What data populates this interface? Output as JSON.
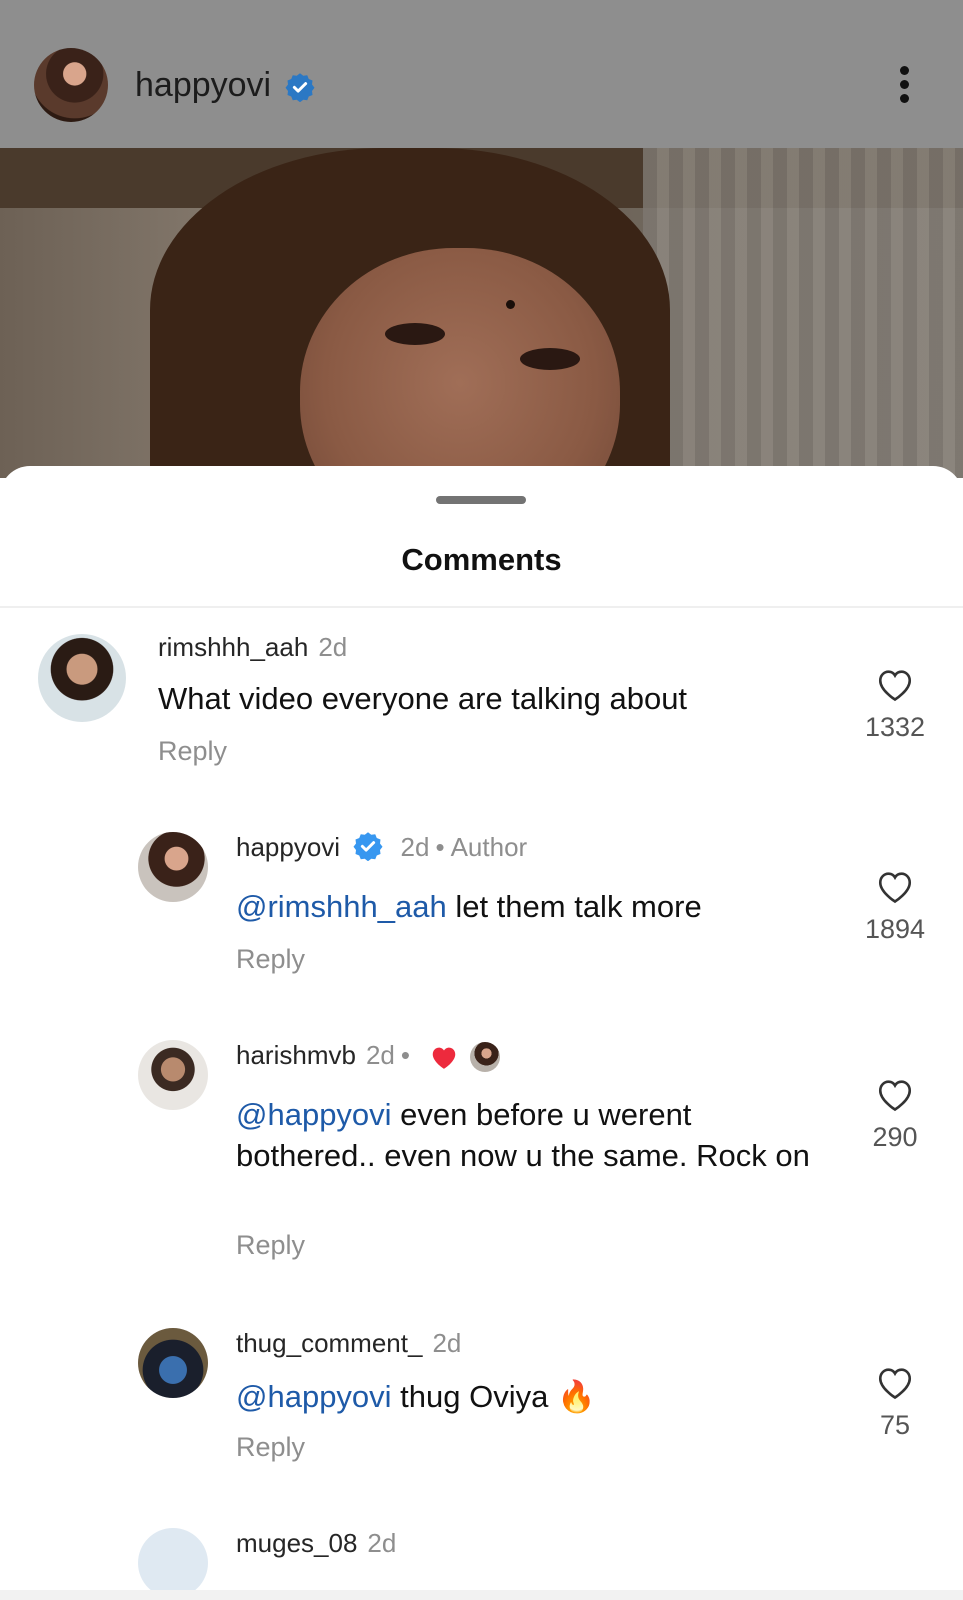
{
  "post_header": {
    "username": "happyovi",
    "verified": true,
    "more_icon": "more-vertical-icon"
  },
  "sheet": {
    "title": "Comments"
  },
  "comments": [
    {
      "username": "rimshhh_aah",
      "time": "2d",
      "mention": "",
      "text": "What video everyone are talking about",
      "reply": "Reply",
      "likes": "1332"
    },
    {
      "username": "happyovi",
      "verified": true,
      "time": "2d",
      "dot": "•",
      "author": "Author",
      "mention": "@rimshhh_aah",
      "text": " let them talk more",
      "reply": "Reply",
      "likes": "1894"
    },
    {
      "username": "harishmvb",
      "time": "2d",
      "dot": "•",
      "mention": "@happyovi",
      "text": " even before u werent bothered.. even now u the same. Rock on",
      "reply": "Reply",
      "likes": "290",
      "liked_by_author_icon": "red-heart-icon"
    },
    {
      "username": "thug_comment_",
      "time": "2d",
      "mention": "@happyovi",
      "text": " thug Oviya",
      "emoji": "🔥",
      "reply": "Reply",
      "likes": "75"
    },
    {
      "username": "muges_08",
      "time": "2d"
    }
  ],
  "colors": {
    "mention": "#1e5aa8",
    "verified": "#3797f0",
    "muted": "#8e8e8e"
  }
}
